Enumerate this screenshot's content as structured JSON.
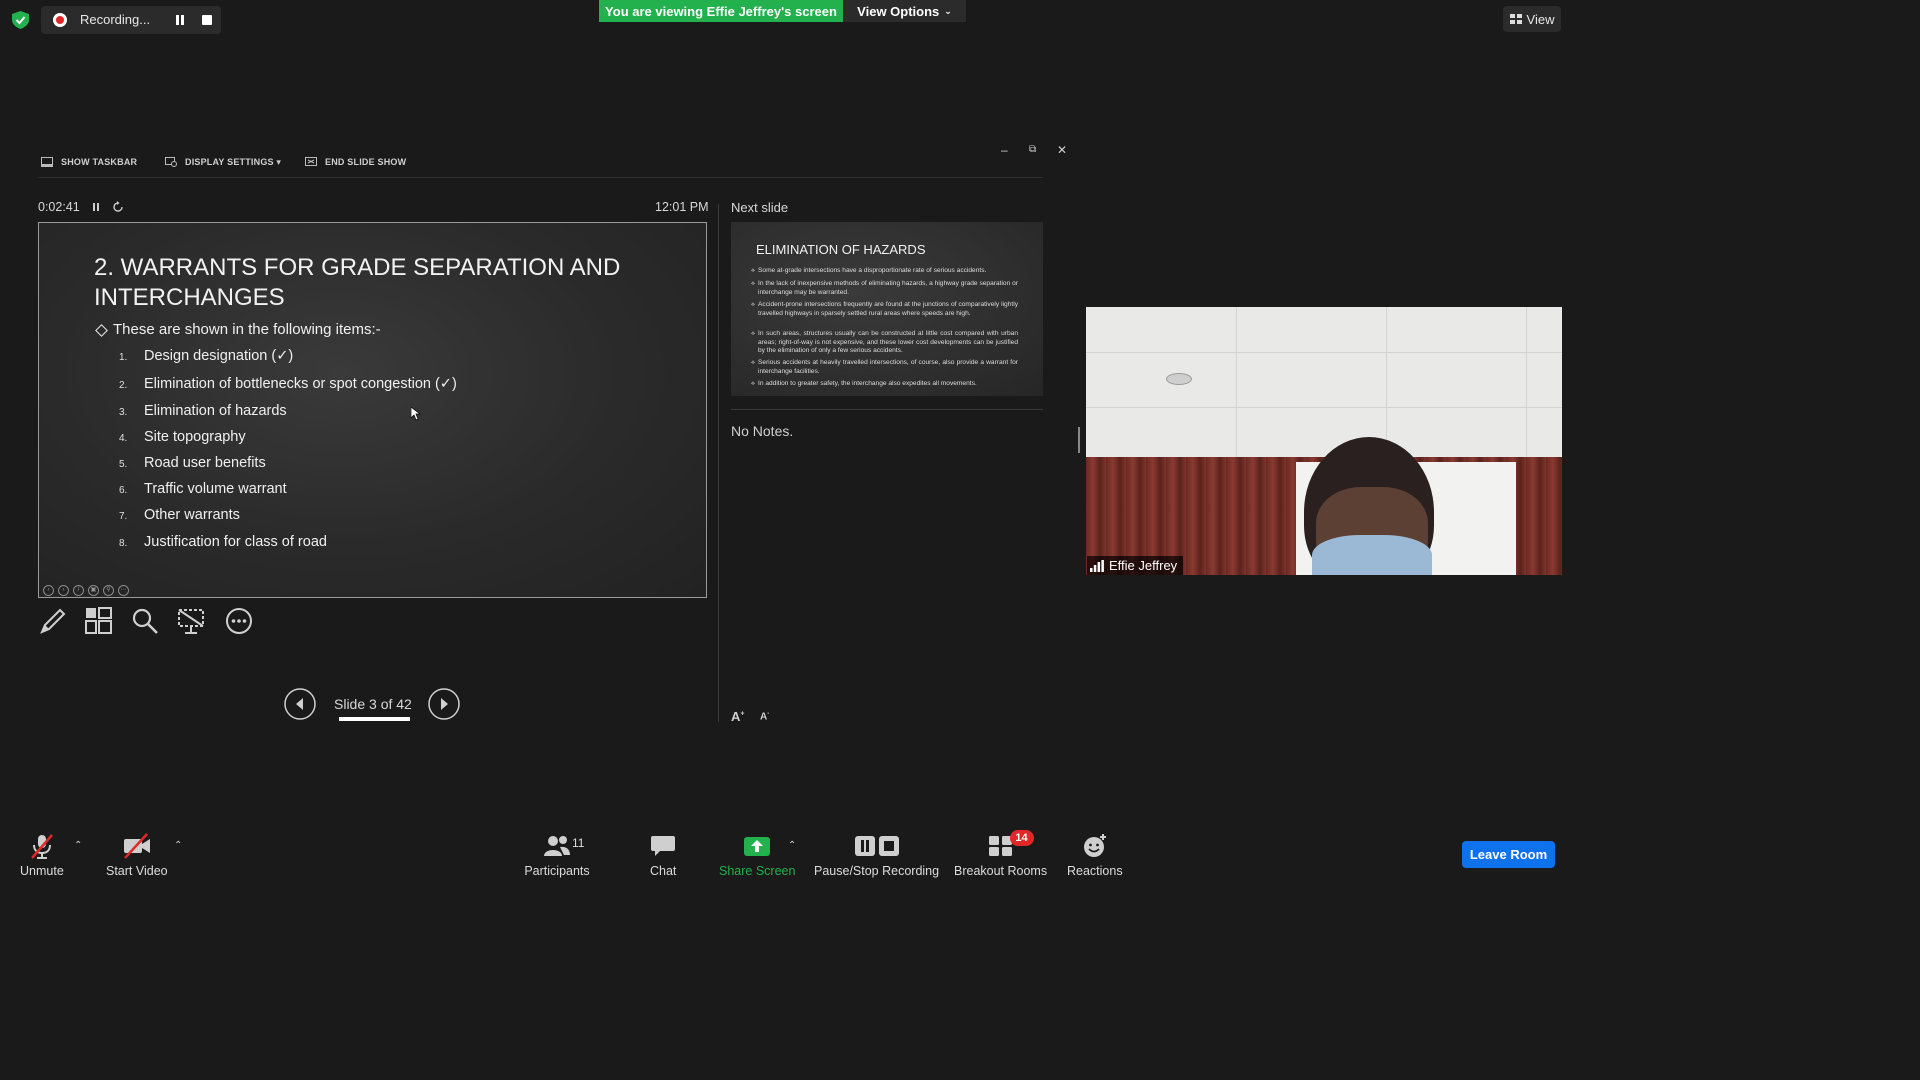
{
  "recording": {
    "label": "Recording..."
  },
  "banner": {
    "viewing": "You are viewing Effie Jeffrey's screen",
    "view_options": "View Options"
  },
  "top_right": {
    "view_label": "View"
  },
  "presenter_toolbar": {
    "show_taskbar": "SHOW TASKBAR",
    "display_settings": "DISPLAY SETTINGS ▾",
    "end_slide_show": "END SLIDE SHOW"
  },
  "presenter": {
    "elapsed": "0:02:41",
    "clock": "12:01 PM",
    "next_slide_label": "Next slide",
    "notes": "No Notes.",
    "slide_counter": "Slide 3 of 42",
    "progress_fraction": 0.071
  },
  "current_slide": {
    "title": "2. WARRANTS FOR GRADE SEPARATION AND INTERCHANGES",
    "intro": "These are shown in the following items:-",
    "items": [
      {
        "num": "1.",
        "text": "Design designation (✓)"
      },
      {
        "num": "2.",
        "text": "Elimination of bottlenecks or spot congestion (✓)"
      },
      {
        "num": "3.",
        "text": "Elimination of hazards"
      },
      {
        "num": "4.",
        "text": "Site topography"
      },
      {
        "num": "5.",
        "text": "Road user benefits"
      },
      {
        "num": "6.",
        "text": "Traffic volume warrant"
      },
      {
        "num": "7.",
        "text": "Other warrants"
      },
      {
        "num": "8.",
        "text": "Justification for class of road"
      }
    ]
  },
  "next_slide": {
    "title": "ELIMINATION OF HAZARDS",
    "bullets": [
      "Some at-grade intersections have a disproportionate rate of serious accidents.",
      "In the lack of inexpensive methods of eliminating hazards, a highway grade separation or interchange may be warranted.",
      "Accident-prone intersections frequently are found at the junctions of comparatively lightly travelled highways in sparsely settled rural areas where speeds are high.",
      "In such areas, structures usually can be constructed at little cost compared with urban areas; right-of-way is not expensive, and these lower cost developments can be justified by the elimination of only a few serious accidents.",
      "Serious accidents at heavily travelled intersections, of course, also provide a warrant for interchange facilities.",
      "In addition to greater safety, the interchange also expedites all movements."
    ]
  },
  "video": {
    "participant_name": "Effie Jeffrey"
  },
  "bottom_bar": {
    "unmute": "Unmute",
    "start_video": "Start Video",
    "participants": "Participants",
    "participants_count": "11",
    "chat": "Chat",
    "share_screen": "Share Screen",
    "pause_stop_recording": "Pause/Stop Recording",
    "breakout_rooms": "Breakout Rooms",
    "breakout_badge": "14",
    "reactions": "Reactions",
    "leave_room": "Leave Room"
  },
  "colors": {
    "share_green": "#22b14c",
    "leave_blue": "#0e72ed",
    "alert_red": "#e02828"
  }
}
